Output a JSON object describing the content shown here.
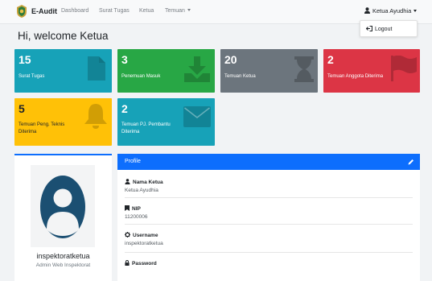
{
  "nav": {
    "brand": "E-Audit",
    "links": [
      "Dashboard",
      "Surat Tugas",
      "Ketua",
      "Temuan"
    ],
    "user": "Ketua Ayudhia"
  },
  "dropdown": {
    "logout": "Logout"
  },
  "welcome": "Hi, welcome Ketua",
  "cards": [
    {
      "value": "15",
      "label": "Surat Tugas",
      "color": "#17a2b8",
      "icon": "file-icon"
    },
    {
      "value": "3",
      "label": "Penemuan Masuk",
      "color": "#28a745",
      "icon": "download-icon"
    },
    {
      "value": "20",
      "label": "Temuan Ketua",
      "color": "#6c757d",
      "icon": "hourglass-icon"
    },
    {
      "value": "2",
      "label": "Temuan Anggota Diterima",
      "color": "#dc3545",
      "icon": "flag-icon"
    },
    {
      "value": "5",
      "label_line1": "Temuan Peng. Teknis",
      "label_line2": "Diterima",
      "color": "#ffc107",
      "icon": "bell-icon"
    },
    {
      "value": "2",
      "label_line1": "Temuan PJ. Pembantu",
      "label_line2": "Diterima",
      "color": "#17a2b8",
      "icon": "envelope-icon"
    }
  ],
  "profile_card": {
    "username": "inspektoratketua",
    "role": "Admin Web Inspektorat"
  },
  "profile": {
    "header": "Profile",
    "fields": [
      {
        "label": "Nama Ketua",
        "value": "Ketua Ayudhia"
      },
      {
        "label": "NIP",
        "value": "11200006"
      },
      {
        "label": "Username",
        "value": "inspektoratketua"
      },
      {
        "label": "Password",
        "value": ""
      }
    ]
  },
  "colors": {
    "primary": "#0d6efd",
    "navbar": "#f8f9fa",
    "page_bg": "#f1f3f5"
  }
}
